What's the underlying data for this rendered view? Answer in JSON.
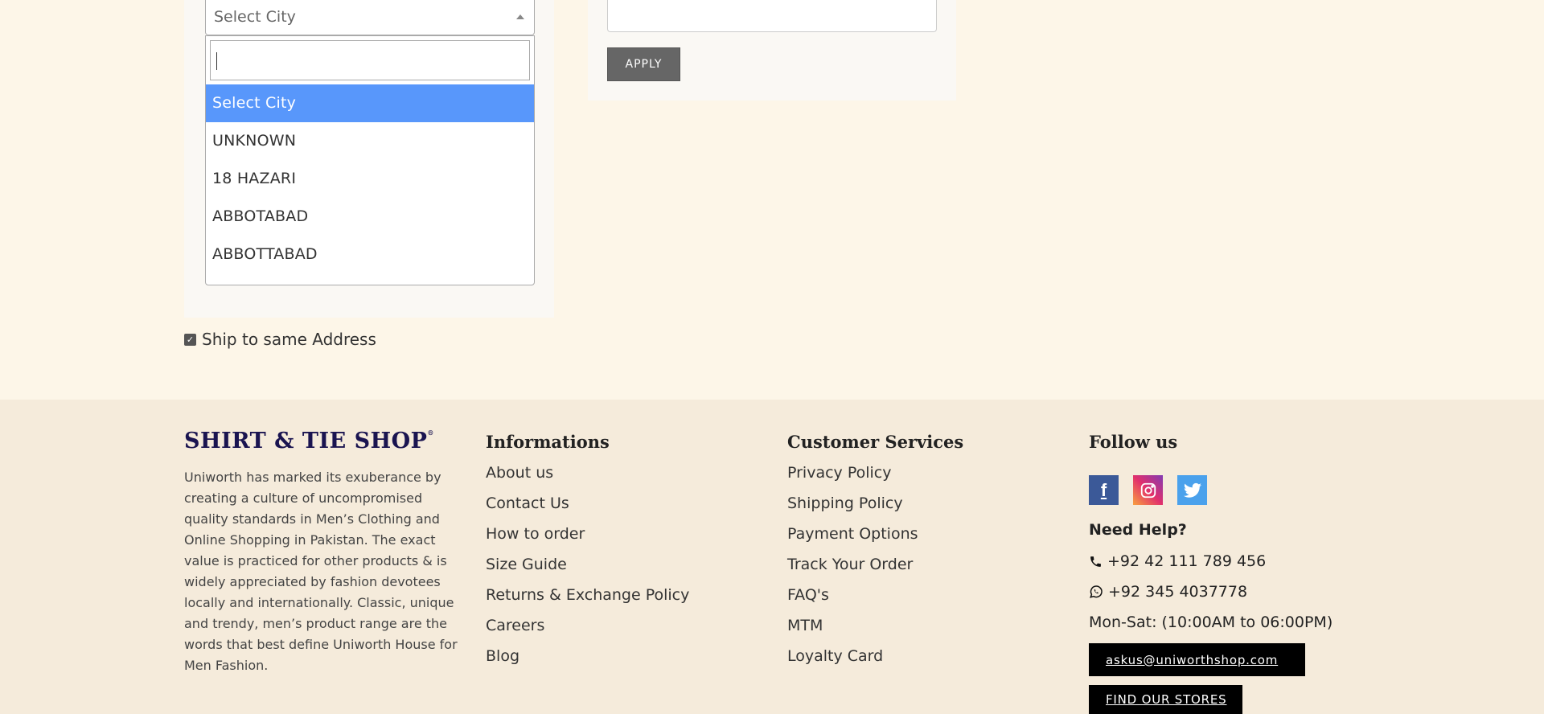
{
  "city_select": {
    "selected_label": "Select City",
    "search_value": "",
    "options": [
      "Select City",
      "UNKNOWN",
      "18 HAZARI",
      "ABBOTABAD",
      "ABBOTTABAD"
    ]
  },
  "coupon": {
    "input_value": "",
    "apply_label": "APPLY"
  },
  "ship_same": {
    "label": "Ship to same Address",
    "checked": true
  },
  "footer": {
    "logo_text": "SHIRT & TIE SHOP",
    "about_text": "Uniworth has marked its exuberance by creating a culture of uncompromised quality standards in Men’s Clothing and Online Shopping in Pakistan. The exact value is practiced for other products & is widely appreciated by fashion devotees locally and internationally. Classic, unique and trendy, men’s product range are the words that best define Uniworth House for Men Fashion.",
    "informations": {
      "title": "Informations",
      "links": [
        "About us",
        "Contact Us",
        "How to order",
        "Size Guide",
        "Returns & Exchange Policy",
        "Careers",
        "Blog"
      ]
    },
    "customer_services": {
      "title": "Customer Services",
      "links": [
        "Privacy Policy",
        "Shipping Policy",
        "Payment Options",
        "Track Your Order",
        "FAQ's",
        "MTM",
        "Loyalty Card"
      ]
    },
    "follow": {
      "title": "Follow us",
      "social_icons": [
        "facebook-icon",
        "instagram-icon",
        "twitter-icon"
      ]
    },
    "help": {
      "title": "Need Help?",
      "phone": "+92 42 111 789 456",
      "whatsapp": "+92 345 4037778",
      "hours": "Mon-Sat: (10:00AM to 06:00PM)",
      "email_button": "askus@uniworthshop.com",
      "stores_button": "FIND OUR STORES"
    }
  },
  "colors": {
    "page_bg": "#fdf6e8",
    "footer_bg": "#f5ebdb",
    "highlight": "#5897fb",
    "logo": "#1a1450"
  }
}
